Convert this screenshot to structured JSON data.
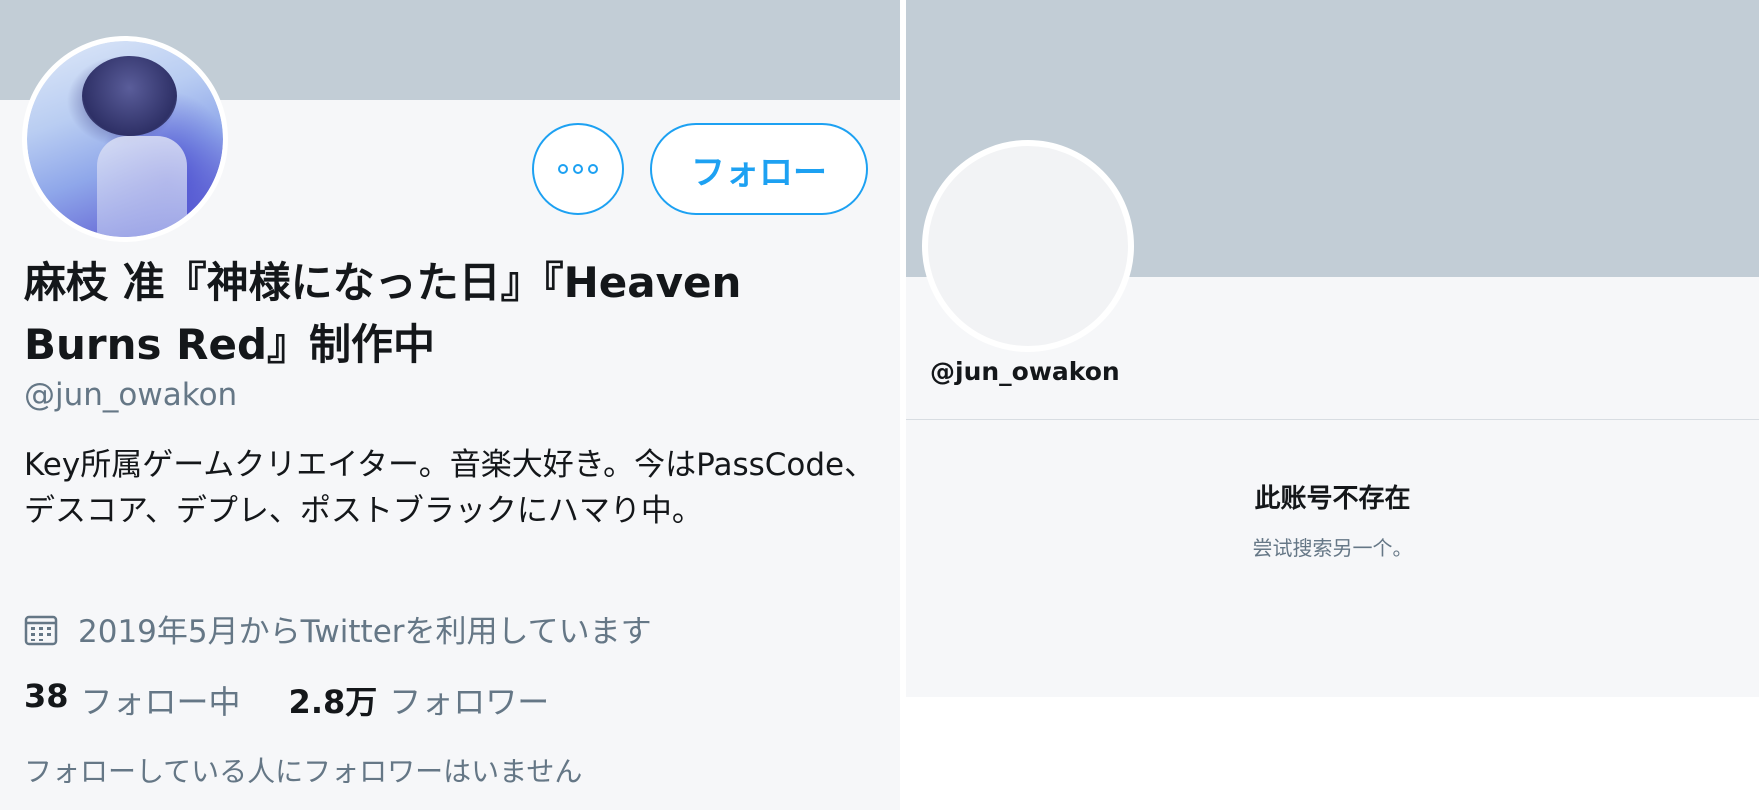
{
  "left_profile": {
    "display_name": "麻枝 准『神様になった日』『Heaven Burns Red』制作中",
    "handle": "@jun_owakon",
    "bio": "Key所属ゲームクリエイター。音楽大好き。今はPassCode、デスコア、デプレ、ポストブラックにハマり中。",
    "joined": "2019年5月からTwitterを利用しています",
    "following_count": "38",
    "following_label": "フォロー中",
    "followers_count": "2.8万",
    "followers_label": "フォロワー",
    "follow_button": "フォロー",
    "no_mutuals": "フォローしている人にフォロワーはいません",
    "icons": [
      "more-icon",
      "calendar-icon"
    ],
    "colors": {
      "accent": "#1da1f2",
      "banner": "#c2cdd6",
      "secondary_text": "#657786"
    }
  },
  "right_profile": {
    "handle": "@jun_owakon",
    "notice_title": "此账号不存在",
    "notice_subtitle": "尝试搜索另一个。"
  }
}
